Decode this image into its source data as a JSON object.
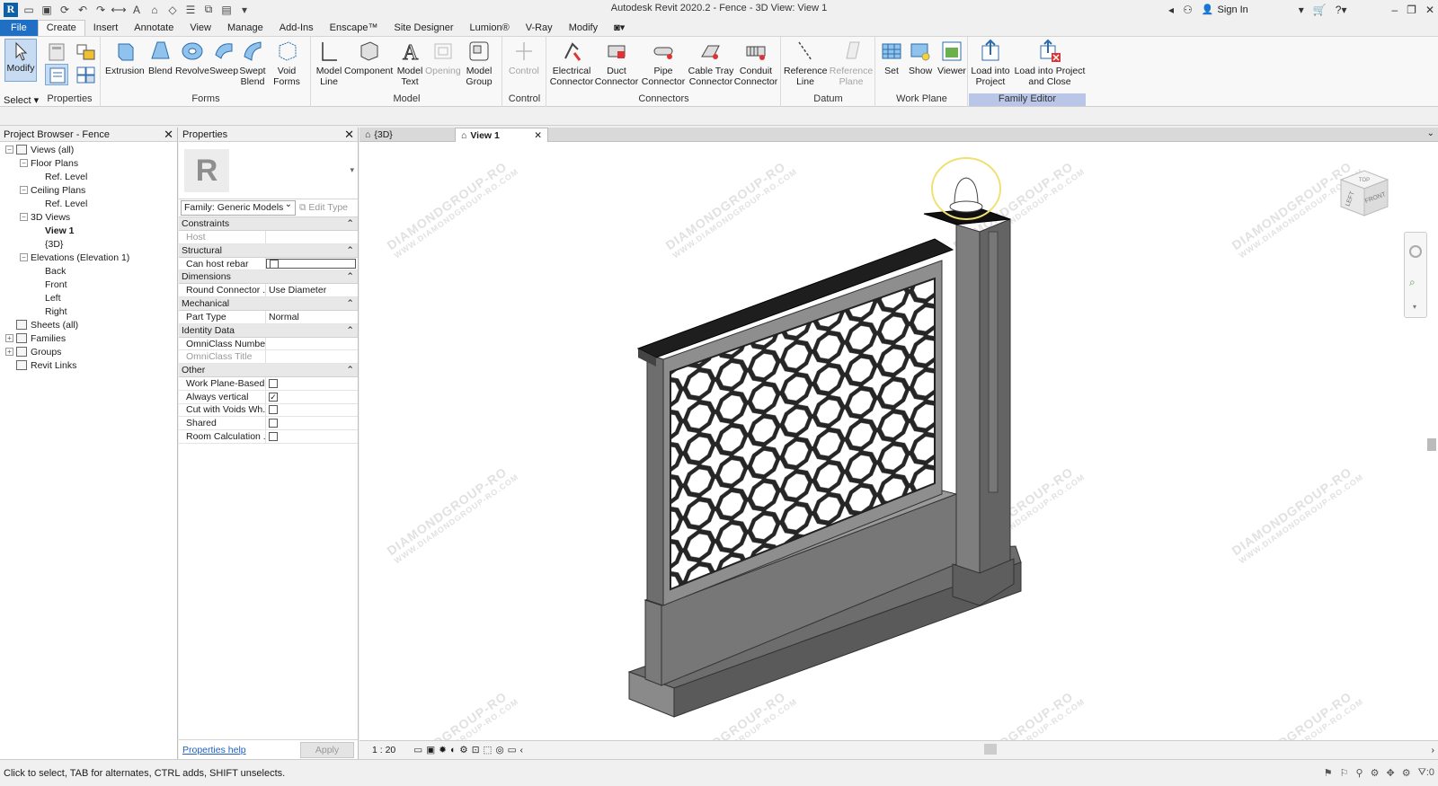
{
  "app": {
    "title": "Autodesk Revit 2020.2 - Fence - 3D View: View 1",
    "sign_in": "Sign In",
    "logo_letter": "R"
  },
  "tabs": [
    "File",
    "Create",
    "Insert",
    "Annotate",
    "View",
    "Manage",
    "Add-Ins",
    "Enscape™",
    "Site Designer",
    "Lumion®",
    "V-Ray",
    "Modify"
  ],
  "active_tab": "Create",
  "ribbon": {
    "select": {
      "modify": "Modify",
      "select_label": "Select",
      "properties_label": "Properties"
    },
    "forms": {
      "label": "Forms",
      "buttons": [
        "Extrusion",
        "Blend",
        "Revolve",
        "Sweep",
        "Swept Blend",
        "Void Forms"
      ]
    },
    "model": {
      "label": "Model",
      "buttons": [
        "Model Line",
        "Component",
        "Model Text",
        "Opening",
        "Model Group"
      ]
    },
    "control": {
      "label": "Control",
      "buttons": [
        "Control"
      ]
    },
    "connectors": {
      "label": "Connectors",
      "buttons": [
        "Electrical Connector",
        "Duct Connector",
        "Pipe Connector",
        "Cable Tray Connector",
        "Conduit Connector"
      ]
    },
    "datum": {
      "label": "Datum",
      "buttons": [
        "Reference Line",
        "Reference Plane"
      ]
    },
    "workplane": {
      "label": "Work Plane",
      "buttons": [
        "Set",
        "Show",
        "Viewer"
      ]
    },
    "family_editor": {
      "label": "Family Editor",
      "buttons": [
        "Load into Project",
        "Load into Project and Close"
      ]
    }
  },
  "project_browser": {
    "title": "Project Browser - Fence",
    "nodes": [
      {
        "label": "Views (all)",
        "depth": 0,
        "exp": "−"
      },
      {
        "label": "Floor Plans",
        "depth": 1,
        "exp": "−"
      },
      {
        "label": "Ref. Level",
        "depth": 2
      },
      {
        "label": "Ceiling Plans",
        "depth": 1,
        "exp": "−"
      },
      {
        "label": "Ref. Level",
        "depth": 2
      },
      {
        "label": "3D Views",
        "depth": 1,
        "exp": "−"
      },
      {
        "label": "View 1",
        "depth": 2,
        "bold": true
      },
      {
        "label": "{3D}",
        "depth": 2
      },
      {
        "label": "Elevations (Elevation 1)",
        "depth": 1,
        "exp": "−"
      },
      {
        "label": "Back",
        "depth": 2
      },
      {
        "label": "Front",
        "depth": 2
      },
      {
        "label": "Left",
        "depth": 2
      },
      {
        "label": "Right",
        "depth": 2
      },
      {
        "label": "Sheets (all)",
        "depth": 0
      },
      {
        "label": "Families",
        "depth": 0,
        "exp": "+"
      },
      {
        "label": "Groups",
        "depth": 0,
        "exp": "+"
      },
      {
        "label": "Revit Links",
        "depth": 0
      }
    ]
  },
  "properties": {
    "title": "Properties",
    "family": "Family: Generic Models",
    "edit_type": "Edit Type",
    "sections": [
      {
        "name": "Constraints",
        "rows": [
          {
            "k": "Host",
            "v": "",
            "dim": true
          }
        ]
      },
      {
        "name": "Structural",
        "rows": [
          {
            "k": "Can host rebar",
            "cb": false,
            "wide": true
          }
        ]
      },
      {
        "name": "Dimensions",
        "rows": [
          {
            "k": "Round Connector ...",
            "v": "Use Diameter"
          }
        ]
      },
      {
        "name": "Mechanical",
        "rows": [
          {
            "k": "Part Type",
            "v": "Normal"
          }
        ]
      },
      {
        "name": "Identity Data",
        "rows": [
          {
            "k": "OmniClass Number",
            "v": ""
          },
          {
            "k": "OmniClass Title",
            "v": "",
            "dim": true
          }
        ]
      },
      {
        "name": "Other",
        "rows": [
          {
            "k": "Work Plane-Based",
            "cb": false
          },
          {
            "k": "Always vertical",
            "cb": true
          },
          {
            "k": "Cut with Voids Wh...",
            "cb": false
          },
          {
            "k": "Shared",
            "cb": false
          },
          {
            "k": "Room Calculation ...",
            "cb": false
          }
        ]
      }
    ],
    "help": "Properties help",
    "apply": "Apply"
  },
  "view_tabs": [
    {
      "label": "{3D}",
      "active": false
    },
    {
      "label": "View 1",
      "active": true
    }
  ],
  "viewbar": {
    "scale": "1 : 20"
  },
  "viewcube": {
    "left": "LEFT",
    "front": "FRONT",
    "top": "TOP"
  },
  "status": {
    "text": "Click to select, TAB for alternates, CTRL adds, SHIFT unselects.",
    "filter_count": ":0"
  },
  "watermark": {
    "line1": "DIAMONDGROUP-RO",
    "line2": "WWW.DIAMONDGROUP-RO.COM"
  }
}
